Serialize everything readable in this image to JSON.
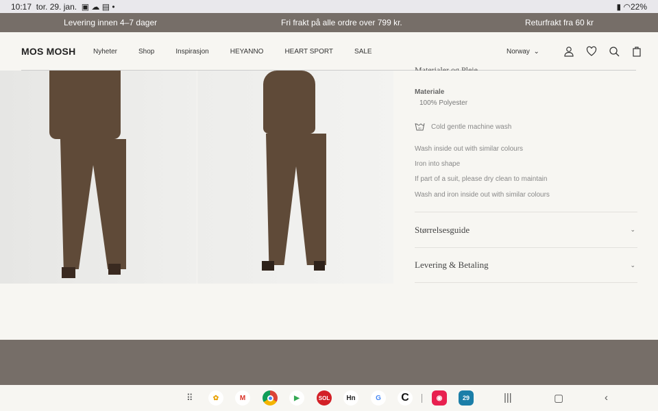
{
  "status_bar": {
    "time": "10:17",
    "date": "tor. 29. jan.",
    "battery": "22%"
  },
  "promo": [
    "Levering innen 4–7 dager",
    "Fri frakt på alle ordre over 799 kr.",
    "Returfrakt fra 60 kr"
  ],
  "header": {
    "logo": "MOS MOSH",
    "nav": [
      "Nyheter",
      "Shop",
      "Inspirasjon",
      "HEYANNO",
      "HEART SPORT",
      "SALE"
    ],
    "country": "Norway"
  },
  "product_info": {
    "section_title": "Materialer og Pleie",
    "material_label": "Materiale",
    "material_value": "100% Polyester",
    "wash_symbol": "wash-30-icon",
    "wash": "Cold gentle machine wash",
    "care": [
      "Wash inside out with similar colours",
      "Iron into shape",
      "If part of a suit, please dry clean to maintain",
      "Wash and iron inside out with similar colours"
    ],
    "accordions": [
      "Størrelsesguide",
      "Levering & Betaling"
    ]
  },
  "taskbar": {
    "apps": [
      "Photos",
      "Gmail",
      "Chrome",
      "Play Store",
      "SOL",
      "Hn",
      "Google",
      "C",
      "Camera",
      "Calendar"
    ],
    "calendar_day": "29"
  },
  "colors": {
    "promo_bg": "#766e68",
    "page_bg": "#f7f6f2",
    "product_brown": "#5f4a38"
  }
}
